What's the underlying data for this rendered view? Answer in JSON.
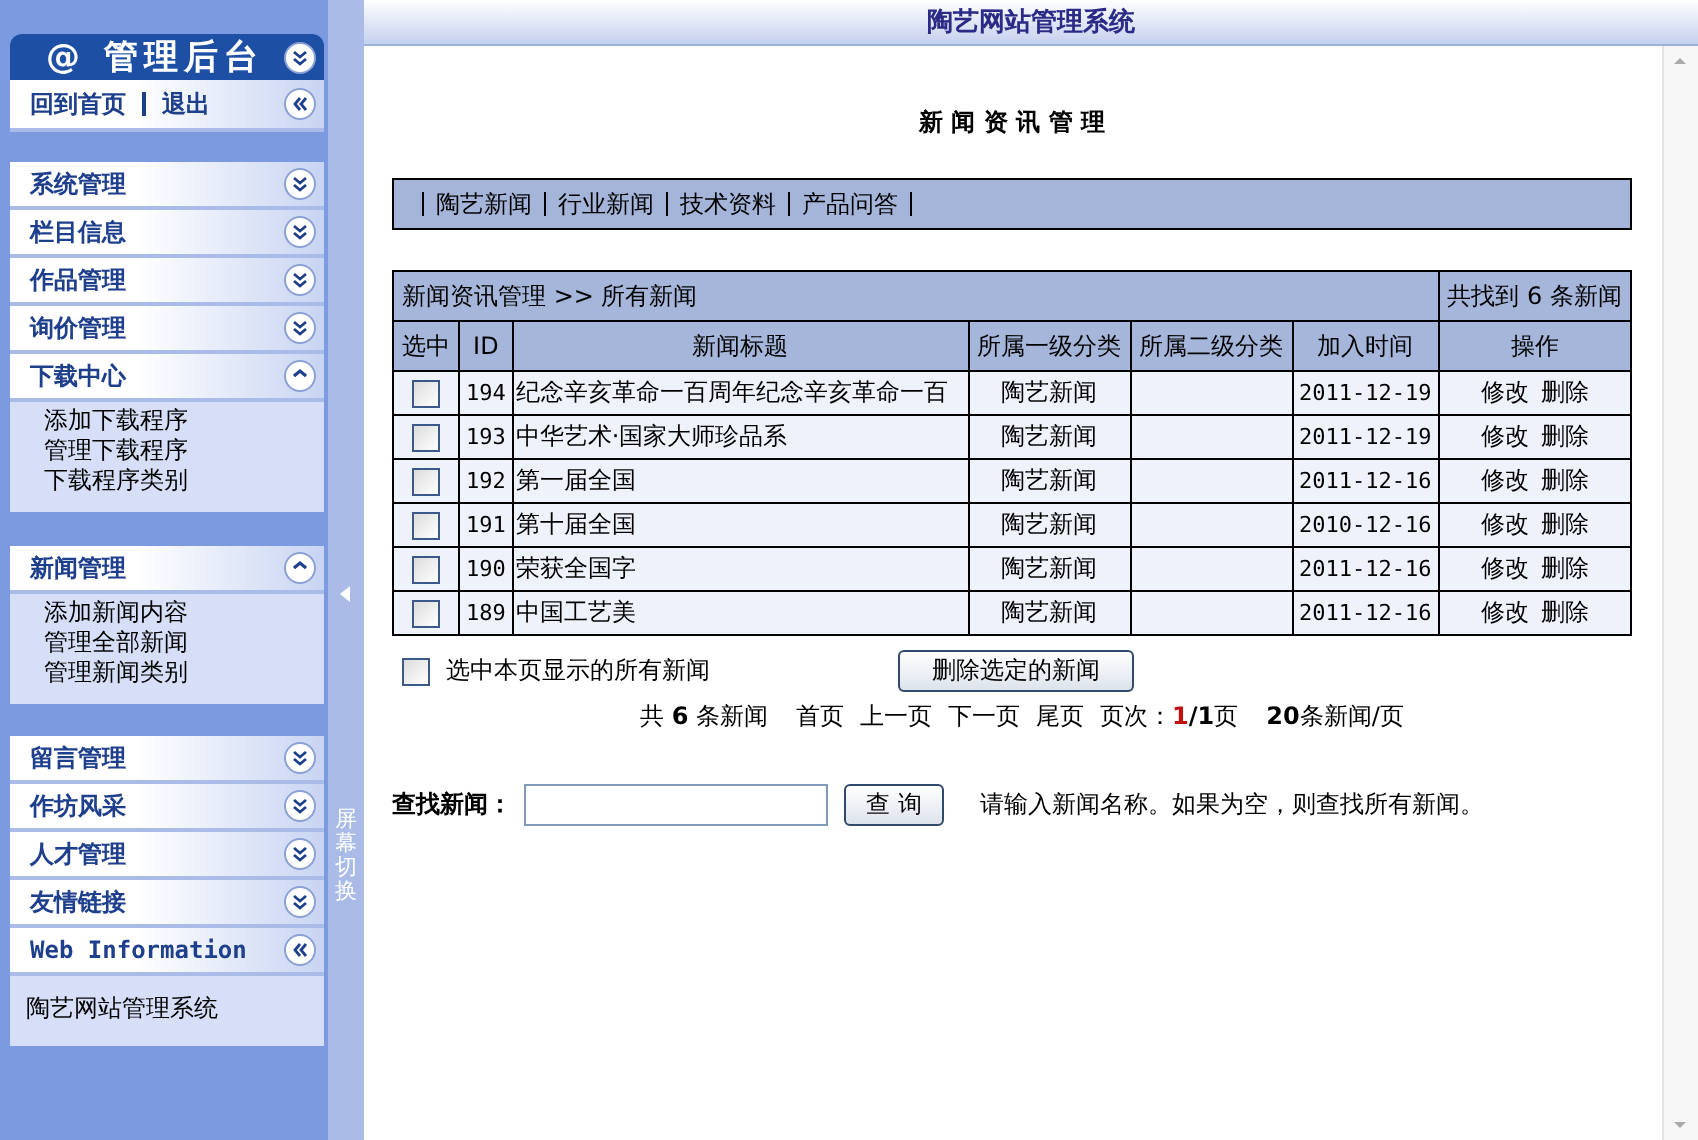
{
  "header": {
    "title": "陶艺网站管理系统"
  },
  "sidebar": {
    "title": "@ 管理后台",
    "links": [
      {
        "label": "回到首页"
      },
      {
        "label": "退出"
      }
    ],
    "sections": [
      {
        "groups": [
          {
            "kind": "menu",
            "title": "系统管理",
            "expanded": false
          },
          {
            "kind": "menu",
            "title": "栏目信息",
            "expanded": false
          },
          {
            "kind": "menu",
            "title": "作品管理",
            "expanded": false
          },
          {
            "kind": "menu",
            "title": "询价管理",
            "expanded": false
          },
          {
            "kind": "menu",
            "title": "下载中心",
            "expanded": true,
            "items": [
              "添加下载程序",
              "管理下载程序",
              "下载程序类别"
            ]
          }
        ]
      },
      {
        "groups": [
          {
            "kind": "menu",
            "title": "新闻管理",
            "expanded": true,
            "items": [
              "添加新闻内容",
              "管理全部新闻",
              "管理新闻类别"
            ]
          }
        ]
      },
      {
        "groups": [
          {
            "kind": "menu",
            "title": "留言管理",
            "expanded": false
          },
          {
            "kind": "menu",
            "title": "作坊风采",
            "expanded": false
          },
          {
            "kind": "menu",
            "title": "人才管理",
            "expanded": false
          },
          {
            "kind": "menu",
            "title": "友情链接",
            "expanded": false
          },
          {
            "kind": "info",
            "title": "Web Information",
            "text": "陶艺网站管理系统"
          }
        ]
      }
    ]
  },
  "toggle_strip": {
    "label": "屏幕切换"
  },
  "main": {
    "page_title": "新 闻 资 讯 管 理",
    "categories": [
      "陶艺新闻",
      "行业新闻",
      "技术资料",
      "产品问答"
    ],
    "table": {
      "breadcrumb": "新闻资讯管理 >> 所有新闻",
      "found": "共找到 6 条新闻",
      "columns": [
        "选中",
        "ID",
        "新闻标题",
        "所属一级分类",
        "所属二级分类",
        "加入时间",
        "操作"
      ],
      "rows": [
        {
          "checked": false,
          "id": "194",
          "title": "纪念辛亥革命一百周年纪念辛亥革命一百",
          "category": "陶艺新闻",
          "date": "2011-12-19",
          "actions": [
            "修改",
            "删除"
          ]
        },
        {
          "checked": false,
          "id": "193",
          "title": "中华艺术·国家大师珍品系",
          "category": "陶艺新闻",
          "date": "2011-12-19",
          "actions": [
            "修改",
            "删除"
          ]
        },
        {
          "checked": false,
          "id": "192",
          "title": "第一届全国",
          "category": "陶艺新闻",
          "date": "2011-12-16",
          "actions": [
            "修改",
            "删除"
          ]
        },
        {
          "checked": false,
          "id": "191",
          "title": "第十届全国",
          "category": "陶艺新闻",
          "date": "2010-12-16",
          "actions": [
            "修改",
            "删除"
          ]
        },
        {
          "checked": false,
          "id": "190",
          "title": "荣获全国字",
          "category": "陶艺新闻",
          "date": "2011-12-16",
          "actions": [
            "修改",
            "删除"
          ]
        },
        {
          "checked": false,
          "id": "189",
          "title": "中国工艺美",
          "category": "陶艺新闻",
          "date": "2011-12-16",
          "actions": [
            "修改",
            "删除"
          ]
        }
      ]
    },
    "select_all": {
      "label": "选中本页显示的所有新闻",
      "checked": false
    },
    "delete_button": "删除选定的新闻",
    "pagination": {
      "summary": "共 **6** 条新闻",
      "links": [
        "首页",
        "上一页",
        "下一页",
        "尾页"
      ],
      "page_label": "页次：",
      "current": "1",
      "total": "**/1**页",
      "per_page": "**20**条新闻/页"
    },
    "search": {
      "label": "查找新闻：",
      "button": "查 询",
      "hint": "请输入新闻名称。如果为空，则查找所有新闻。"
    }
  }
}
